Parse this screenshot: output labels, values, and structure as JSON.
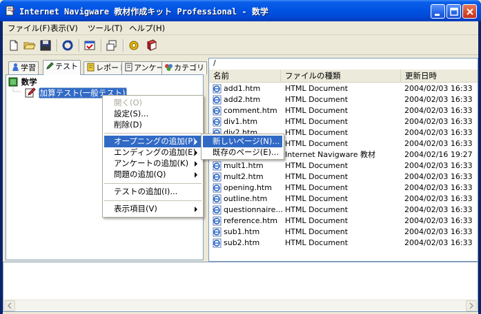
{
  "window": {
    "title": "Internet Navigware 教材作成キット Professional - 数学"
  },
  "menubar": {
    "items": [
      "ファイル(F)",
      "表示(V)",
      "ツール(T)",
      "ヘルプ(H)"
    ]
  },
  "toolbar": {
    "buttons": [
      "new-icon",
      "open-icon",
      "save-icon",
      "refresh-icon",
      "check-icon",
      "window-icon",
      "gear-icon",
      "book-icon"
    ]
  },
  "left_tabs": [
    {
      "label": "学習",
      "icon": "person-icon"
    },
    {
      "label": "テスト",
      "icon": "pencil-icon"
    },
    {
      "label": "レポート",
      "icon": "report-icon"
    },
    {
      "label": "アンケート",
      "icon": "survey-icon"
    },
    {
      "label": "カテゴリ",
      "icon": "category-icon"
    }
  ],
  "tree": {
    "root": "数学",
    "child": "加算テスト(一般テスト)"
  },
  "context_menu": {
    "items": [
      {
        "label": "開く(O)",
        "disabled": true
      },
      {
        "label": "設定(S)..."
      },
      {
        "label": "削除(D)"
      },
      {
        "label": "オープニングの追加(P)",
        "submenu": true,
        "highlighted": true
      },
      {
        "label": "エンディングの追加(E)",
        "submenu": true
      },
      {
        "label": "アンケートの追加(K)",
        "submenu": true
      },
      {
        "label": "問題の追加(Q)",
        "submenu": true
      },
      {
        "label": "テストの追加(I)..."
      },
      {
        "label": "表示項目(V)",
        "submenu": true
      }
    ]
  },
  "submenu": {
    "items": [
      {
        "label": "新しいページ(N)...",
        "highlighted": true
      },
      {
        "label": "既存のページ(E)..."
      }
    ]
  },
  "right_pane": {
    "path": "/",
    "columns": [
      "名前",
      "ファイルの種類",
      "更新日時"
    ],
    "files": [
      {
        "name": "add1.htm",
        "type": "HTML Document",
        "date": "2004/02/03 16:33"
      },
      {
        "name": "add2.htm",
        "type": "HTML Document",
        "date": "2004/02/03 16:33"
      },
      {
        "name": "comment.htm",
        "type": "HTML Document",
        "date": "2004/02/03 16:33"
      },
      {
        "name": "div1.htm",
        "type": "HTML Document",
        "date": "2004/02/03 16:33"
      },
      {
        "name": "div2.htm",
        "type": "HTML Document",
        "date": "2004/02/03 16:33"
      },
      {
        "name": "",
        "type": "HTML Document",
        "date": "2004/02/03 16:33"
      },
      {
        "name": "",
        "type": "Internet Navigware 教材",
        "date": "2004/02/16 19:27"
      },
      {
        "name": "mult1.htm",
        "type": "HTML Document",
        "date": "2004/02/03 16:33"
      },
      {
        "name": "mult2.htm",
        "type": "HTML Document",
        "date": "2004/02/03 16:33"
      },
      {
        "name": "opening.htm",
        "type": "HTML Document",
        "date": "2004/02/03 16:33"
      },
      {
        "name": "outline.htm",
        "type": "HTML Document",
        "date": "2004/02/03 16:33"
      },
      {
        "name": "questionnaire...",
        "type": "HTML Document",
        "date": "2004/02/03 16:33"
      },
      {
        "name": "reference.htm",
        "type": "HTML Document",
        "date": "2004/02/03 16:33"
      },
      {
        "name": "sub1.htm",
        "type": "HTML Document",
        "date": "2004/02/03 16:33"
      },
      {
        "name": "sub2.htm",
        "type": "HTML Document",
        "date": "2004/02/03 16:33"
      }
    ]
  },
  "colors": {
    "selection": "#316ac5",
    "titlebar": "#0054e3"
  }
}
